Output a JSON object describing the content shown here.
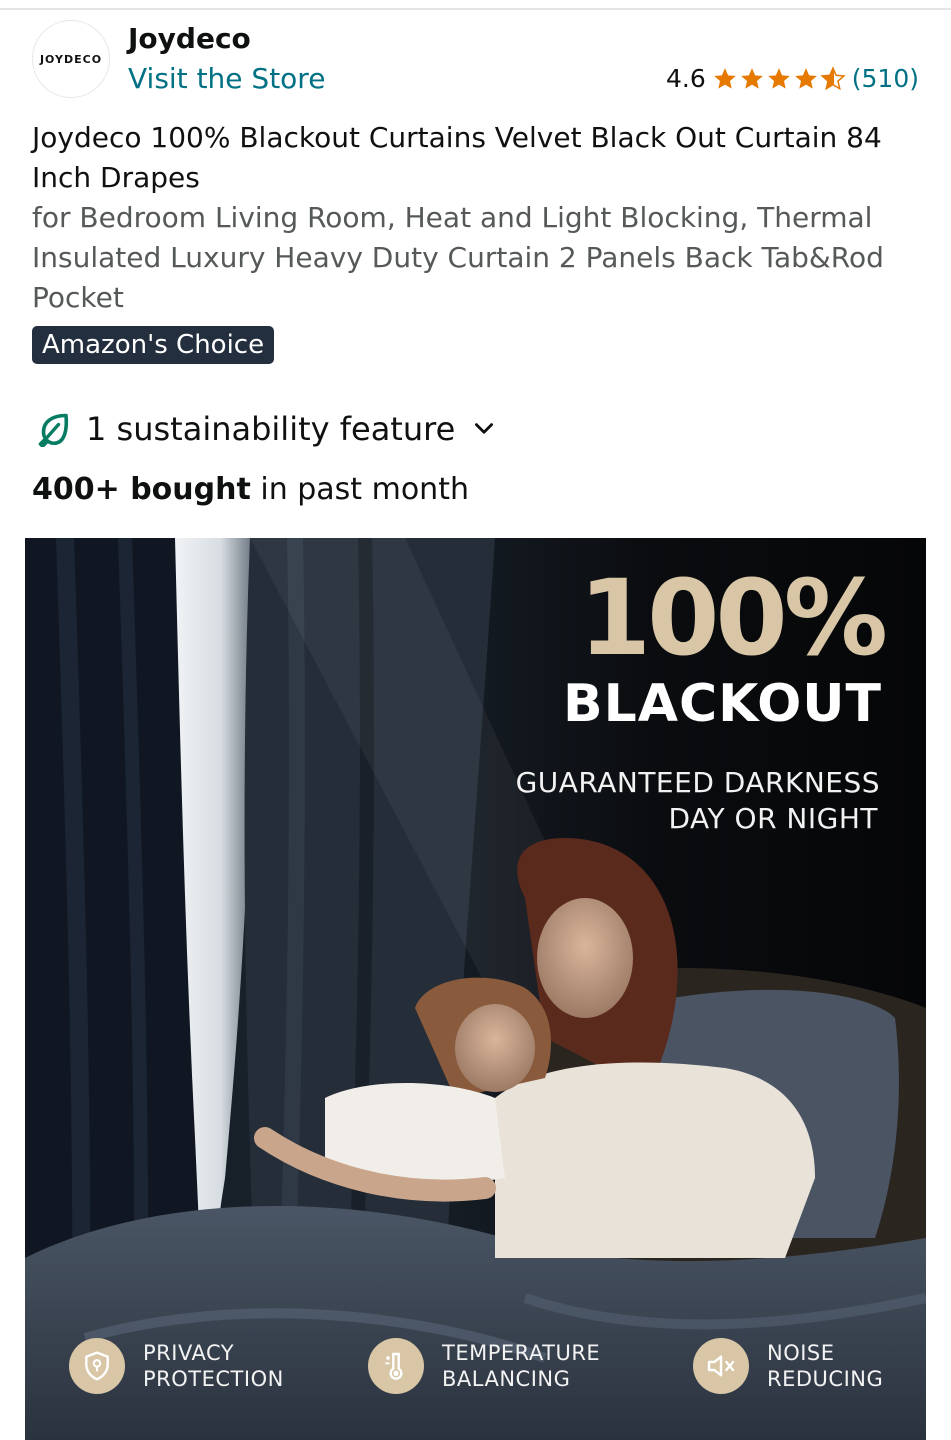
{
  "store": {
    "logo_text": "JOYDECO",
    "brand_name": "Joydeco",
    "visit_store": "Visit the Store",
    "rating_value": "4.6",
    "rating_count": "(510)",
    "star_color": "#e67a00"
  },
  "product": {
    "title_main": "Joydeco 100% Blackout Curtains Velvet Black Out Curtain 84 Inch Drapes",
    "title_sub": "for Bedroom Living Room, Heat and Light Blocking, Thermal Insulated Luxury Heavy Duty Curtain 2 Panels Back Tab&Rod Pocket",
    "badge": "Amazon's Choice",
    "sustainability": "1 sustainability feature",
    "bought_bold": "400+ bought",
    "bought_rest": " in past month"
  },
  "hero": {
    "headline_pct": "100%",
    "headline_word": "BLACKOUT",
    "tagline_1": "GUARANTEED DARKNESS",
    "tagline_2": "DAY OR NIGHT",
    "features": [
      {
        "line1": "PRIVACY",
        "line2": "PROTECTION",
        "icon": "shield-lock-icon"
      },
      {
        "line1": "TEMPERATURE",
        "line2": "BALANCING",
        "icon": "thermometer-icon"
      },
      {
        "line1": "NOISE",
        "line2": "REDUCING",
        "icon": "speaker-mute-icon"
      }
    ],
    "accent_color": "#d8c6a6"
  }
}
